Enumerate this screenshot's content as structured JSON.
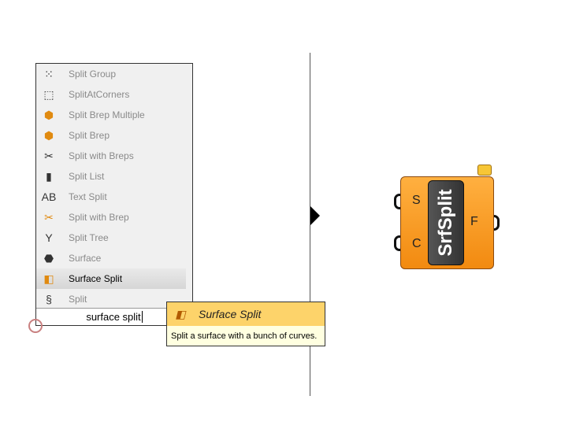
{
  "search_list": {
    "items": [
      {
        "label": "Split Group",
        "icon": "split-group-icon"
      },
      {
        "label": "SplitAtCorners",
        "icon": "split-at-corners-icon"
      },
      {
        "label": "Split Brep Multiple",
        "icon": "split-brep-multiple-icon"
      },
      {
        "label": "Split Brep",
        "icon": "split-brep-icon"
      },
      {
        "label": "Split with Breps",
        "icon": "split-with-breps-icon"
      },
      {
        "label": "Split List",
        "icon": "split-list-icon"
      },
      {
        "label": "Text Split",
        "icon": "text-split-icon"
      },
      {
        "label": "Split with Brep",
        "icon": "split-with-brep-icon"
      },
      {
        "label": "Split Tree",
        "icon": "split-tree-icon"
      },
      {
        "label": "Surface",
        "icon": "surface-icon"
      },
      {
        "label": "Surface Split",
        "icon": "surface-split-icon",
        "selected": true
      },
      {
        "label": "Split",
        "icon": "split-icon"
      }
    ],
    "search_value": "surface split"
  },
  "tooltip": {
    "title": "Surface Split",
    "description": "Split a surface with a bunch of curves."
  },
  "component": {
    "nickname": "SrfSplit",
    "inputs": [
      "S",
      "C"
    ],
    "outputs": [
      "F"
    ],
    "color": "#f5961e"
  }
}
